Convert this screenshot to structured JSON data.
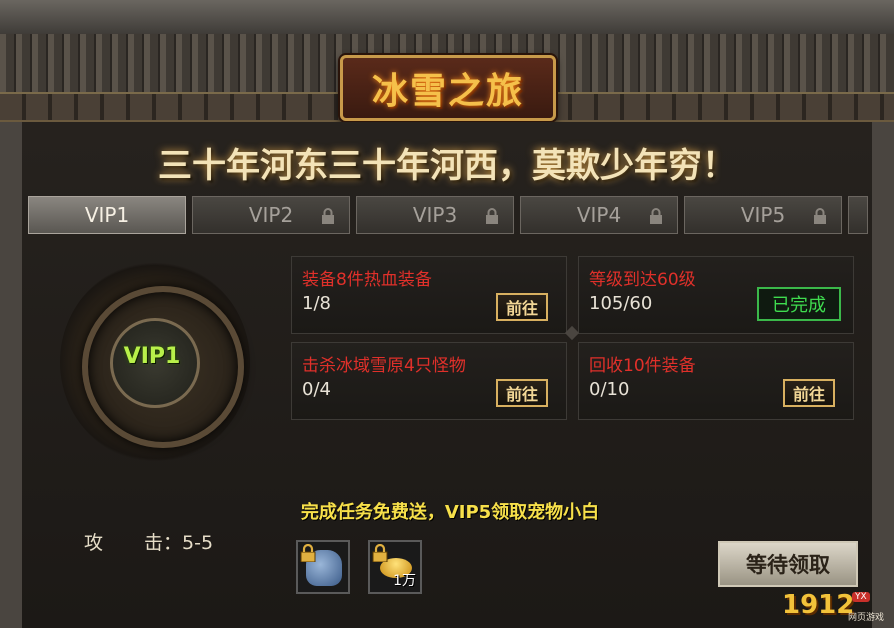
{
  "header": {
    "title": "冰雪之旅",
    "headline": "三十年河东三十年河西，莫欺少年穷！"
  },
  "tabs": [
    {
      "label": "VIP1",
      "active": true,
      "locked": false
    },
    {
      "label": "VIP2",
      "active": false,
      "locked": true
    },
    {
      "label": "VIP3",
      "active": false,
      "locked": true
    },
    {
      "label": "VIP4",
      "active": false,
      "locked": true
    },
    {
      "label": "VIP5",
      "active": false,
      "locked": true
    }
  ],
  "medal": {
    "label": "VIP1"
  },
  "tasks": [
    {
      "name": "装备8件热血装备",
      "progress": "1/8",
      "action": "前往"
    },
    {
      "name": "等级到达60级",
      "progress": "105/60",
      "action": "已完成"
    },
    {
      "name": "击杀冰域雪原4只怪物",
      "progress": "0/4",
      "action": "前往"
    },
    {
      "name": "回收10件装备",
      "progress": "0/10",
      "action": "前往"
    }
  ],
  "reward": {
    "text": "完成任务免费送，VIP5领取宠物小白",
    "attack_label": "攻",
    "attack_value": "击：5-5",
    "items": [
      {
        "icon": "pet-icon",
        "locked": true,
        "qty": ""
      },
      {
        "icon": "gold-ingot-icon",
        "locked": true,
        "qty": "1万"
      }
    ],
    "claim_label": "等待领取"
  },
  "logo": {
    "number": "1912",
    "badge": "YX",
    "sub": "网页游戏"
  },
  "colors": {
    "task_name": "#e0302a",
    "done": "#3fdc4f",
    "reward_text": "#f7e04a",
    "medal_text": "#b8f04a"
  }
}
